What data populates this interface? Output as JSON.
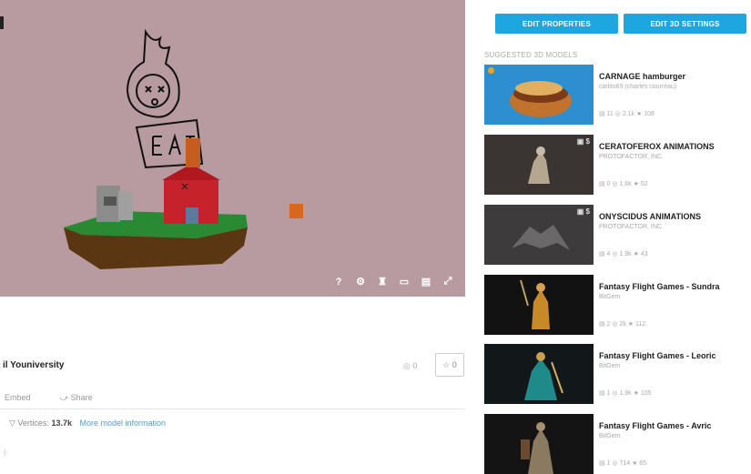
{
  "viewer": {
    "controls": [
      "?",
      "⚙",
      "♜",
      "▭",
      "▤",
      "⤢"
    ],
    "colors": {
      "background": "#b89ba1",
      "house": "#c6222b",
      "ground": "#2a8a34",
      "dirt": "#5a3613"
    }
  },
  "model": {
    "title": "il Youniversity",
    "views": "◎ 0",
    "likes": "☆ 0",
    "embed_label": "Embed",
    "share_label": "Share",
    "vertices_label": "Vertices:",
    "vertices_value": "13.7k",
    "more_info_label": "More model information",
    "footer": "(·"
  },
  "buttons": {
    "edit_properties": "EDIT PROPERTIES",
    "edit_3d_settings": "EDIT 3D SETTINGS"
  },
  "suggested": {
    "heading": "SUGGESTED 3D MODELS",
    "items": [
      {
        "title": "CARNAGE hamburger",
        "author": "carlito69 (charles courreau)",
        "stats": "▤ 11  ◎ 2.1k  ★ 108",
        "price": "",
        "thumb_color": "#2d8fcf"
      },
      {
        "title": "CERATOFEROX ANIMATIONS",
        "author": "PROTOFACTOR, INC.",
        "stats": "▤ 0  ◎ 1.6k  ★ 52",
        "price": "▣ $",
        "thumb_color": "#3a3532"
      },
      {
        "title": "ONYSCIDUS ANIMATIONS",
        "author": "PROTOFACTOR, INC.",
        "stats": "▤ 4  ◎ 1.9k  ★ 43",
        "price": "▣ $",
        "thumb_color": "#3d3b3b"
      },
      {
        "title": "Fantasy Flight Games - Sundra",
        "author": "BitGem",
        "stats": "▤ 2  ◎ 2k  ★ 112",
        "price": "",
        "thumb_color": "#121212"
      },
      {
        "title": "Fantasy Flight Games - Leoric",
        "author": "BitGem",
        "stats": "▤ 1  ◎ 1.9k  ★ 105",
        "price": "",
        "thumb_color": "#12181a"
      },
      {
        "title": "Fantasy Flight Games - Avric",
        "author": "BitGem",
        "stats": "▤ 1  ◎ 714  ★ 65",
        "price": "",
        "thumb_color": "#141414"
      }
    ]
  }
}
